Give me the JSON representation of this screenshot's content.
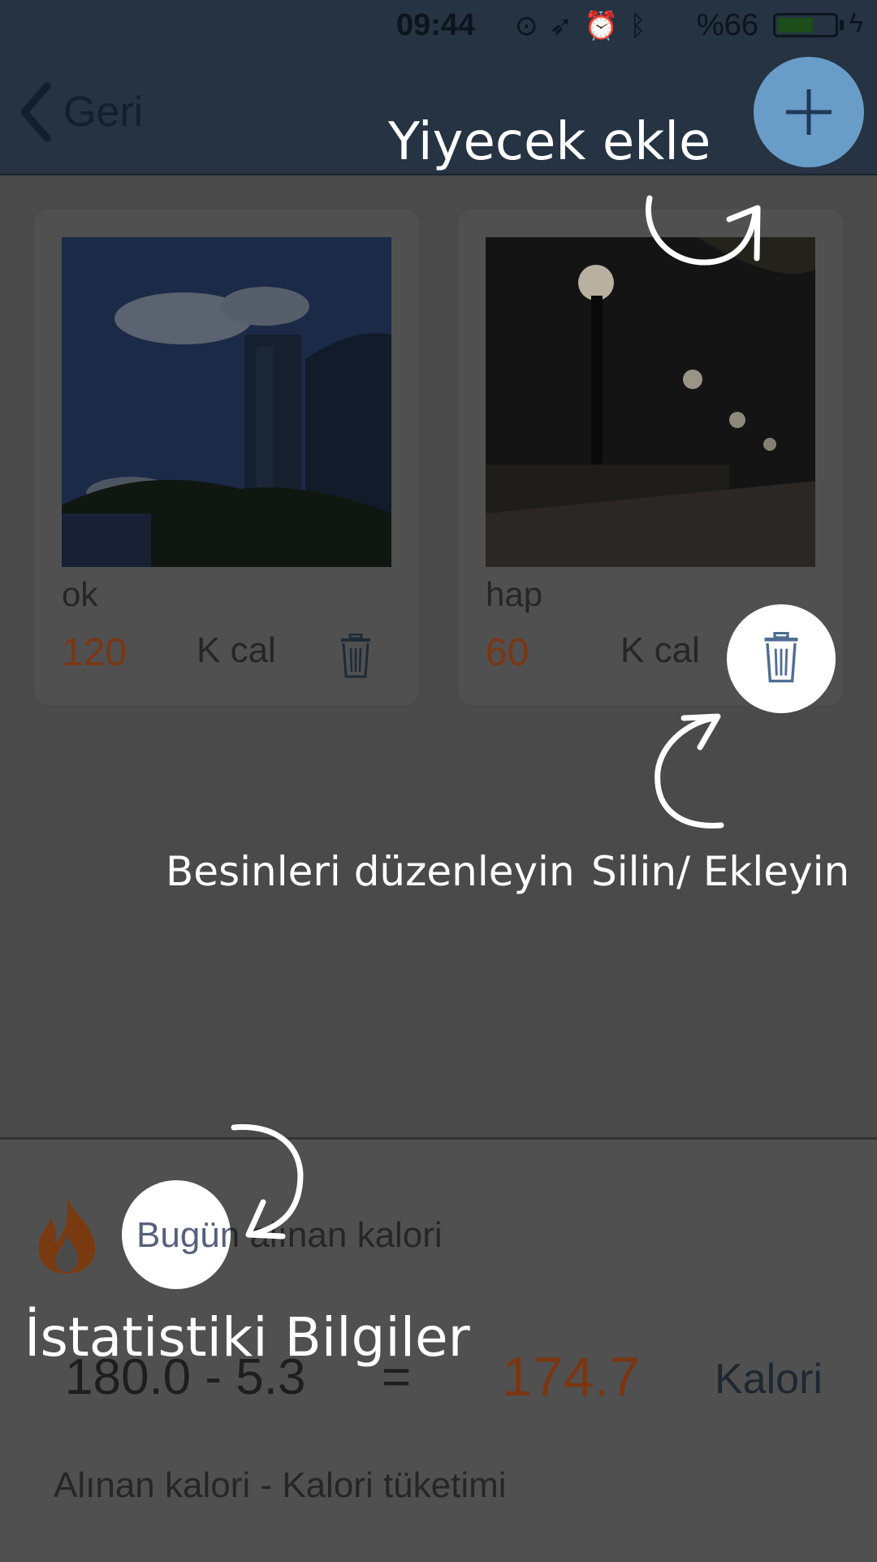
{
  "status_bar": {
    "time": "09:44",
    "icons": [
      "rotation-lock-icon",
      "location-icon",
      "alarm-icon",
      "bluetooth-icon"
    ],
    "battery_text": "%66",
    "battery_level": 0.66,
    "charging": true
  },
  "nav": {
    "back_label": "Geri",
    "add_icon": "plus-icon"
  },
  "foods": [
    {
      "name": "ok",
      "calories": "120",
      "unit": "K cal",
      "photo": "city-building-sky"
    },
    {
      "name": "hap",
      "calories": "60",
      "unit": "K cal",
      "photo": "night-street-lamps"
    }
  ],
  "summary": {
    "icon": "flame-icon",
    "title": "Bugün alınan kalori",
    "formula": "180.0 - 5.3",
    "equals": "=",
    "result": "174.7",
    "unit": "Kalori",
    "explanation": "Alınan kalori - Kalori tüketimi"
  },
  "coach": {
    "add_food": "Yiyecek ekle",
    "edit_foods": "Besinleri düzenleyin",
    "delete_add": "Silin/ Ekleyin",
    "stats": "İstatistiki Bilgiler",
    "spot_today_text": "Bugün"
  },
  "colors": {
    "nav_bg": "#253342",
    "add_button": "#6a9cc8",
    "calorie_accent": "#7a3612",
    "overlay_bg": "#4a4a4a",
    "spotlight": "#ffffff"
  }
}
